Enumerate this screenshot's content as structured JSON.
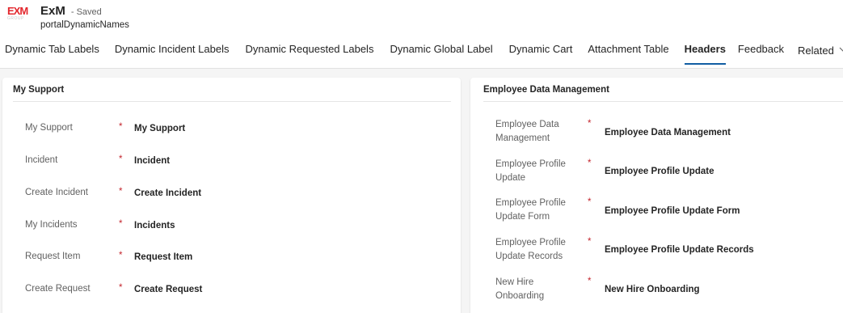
{
  "app": {
    "logo_text": "EXM",
    "logo_subtext": "GROUP",
    "title": "ExM",
    "status": "- Saved",
    "record_name": "portalDynamicNames"
  },
  "tabs": [
    {
      "label": "Dynamic Tab Labels",
      "active": false
    },
    {
      "label": "Dynamic Incident Labels",
      "active": false
    },
    {
      "label": "Dynamic Requested Labels",
      "active": false
    },
    {
      "label": "Dynamic Global Label",
      "active": false
    },
    {
      "label": "Dynamic Cart",
      "active": false
    },
    {
      "label": "Attachment Table",
      "active": false
    },
    {
      "label": "Headers",
      "active": true
    },
    {
      "label": "Feedback",
      "active": false
    },
    {
      "label": "Related",
      "active": false,
      "icon": "chevron-down-icon"
    }
  ],
  "sections": {
    "my_support": {
      "title": "My Support",
      "fields": [
        {
          "label": "My Support",
          "required": "*",
          "value": "My Support"
        },
        {
          "label": "Incident",
          "required": "*",
          "value": "Incident"
        },
        {
          "label": "Create Incident",
          "required": "*",
          "value": "Create Incident"
        },
        {
          "label": "My Incidents",
          "required": "*",
          "value": "Incidents"
        },
        {
          "label": "Request Item",
          "required": "*",
          "value": "Request Item"
        },
        {
          "label": "Create Request",
          "required": "*",
          "value": "Create Request"
        }
      ]
    },
    "employee_data": {
      "title": "Employee Data Management",
      "fields": [
        {
          "label_line1": "Employee Data",
          "label_line2": "Management",
          "required": "*",
          "value": "Employee Data Management"
        },
        {
          "label_line1": "Employee Profile",
          "label_line2": "Update",
          "required": "*",
          "value": "Employee Profile Update"
        },
        {
          "label_line1": "Employee Profile",
          "label_line2": "Update Form",
          "required": "*",
          "value": "Employee Profile Update Form"
        },
        {
          "label_line1": "Employee Profile",
          "label_line2": "Update Records",
          "required": "*",
          "value": "Employee Profile Update Records"
        },
        {
          "label_line1": "New Hire",
          "label_line2": "Onboarding",
          "required": "*",
          "value": "New Hire Onboarding"
        }
      ]
    }
  },
  "colors": {
    "brand_red": "#e3262c",
    "required_red": "#c4262e",
    "active_tab_underline": "#115ea3"
  }
}
